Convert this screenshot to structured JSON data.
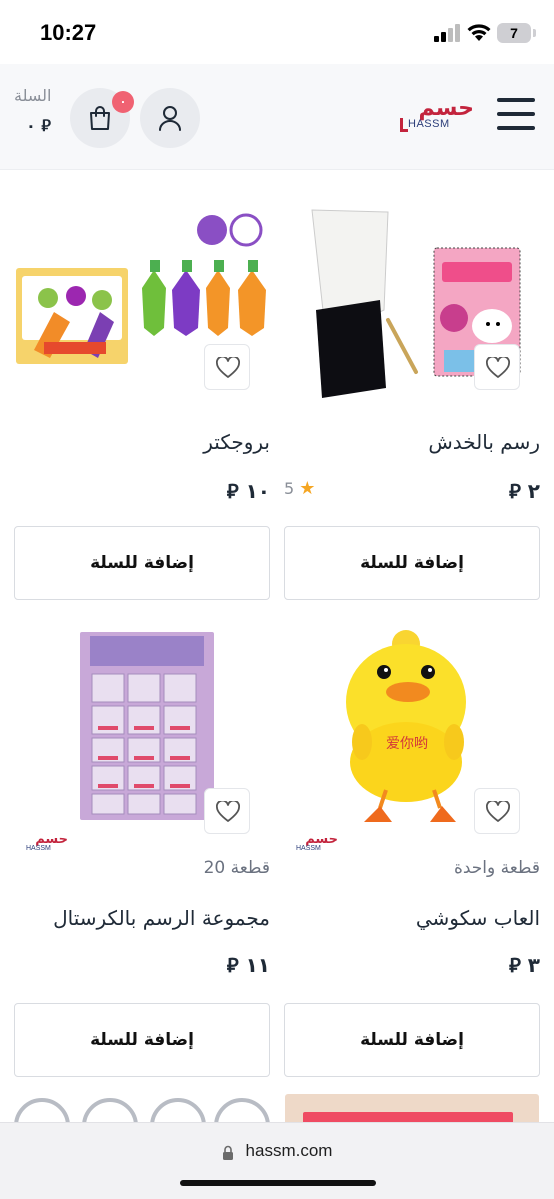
{
  "status_bar": {
    "time": "10:27",
    "battery": "7"
  },
  "header": {
    "cart_label": "السلة",
    "cart_total": "٠ ⃁",
    "cart_count": "٠",
    "logo_ar": "حسم",
    "logo_en": "HASSM",
    "icons": [
      "menu-icon",
      "user-icon",
      "shopping-bag-icon"
    ]
  },
  "products": [
    {
      "title": "رسم بالخدش",
      "price": "٢ ⃁",
      "rating": "5",
      "add_label": "إضافة للسلة"
    },
    {
      "title": "بروجكتر",
      "price": "١٠ ⃁",
      "add_label": "إضافة للسلة"
    },
    {
      "title": "العاب سكوشي",
      "subtitle": "قطعة واحدة",
      "price": "٣ ⃁",
      "add_label": "إضافة للسلة",
      "brand": "حسم",
      "brand_en": "HASSM"
    },
    {
      "title": "مجموعة الرسم بالكرستال",
      "subtitle": "20 قطعة",
      "price": "١١ ⃁",
      "add_label": "إضافة للسلة",
      "brand": "حسم",
      "brand_en": "HASSM"
    }
  ],
  "browser": {
    "url": "hassm.com"
  },
  "colors": {
    "brand_red": "#c3243d",
    "brand_blue": "#2c3e7a",
    "badge": "#f06272",
    "star": "#f5a623"
  }
}
